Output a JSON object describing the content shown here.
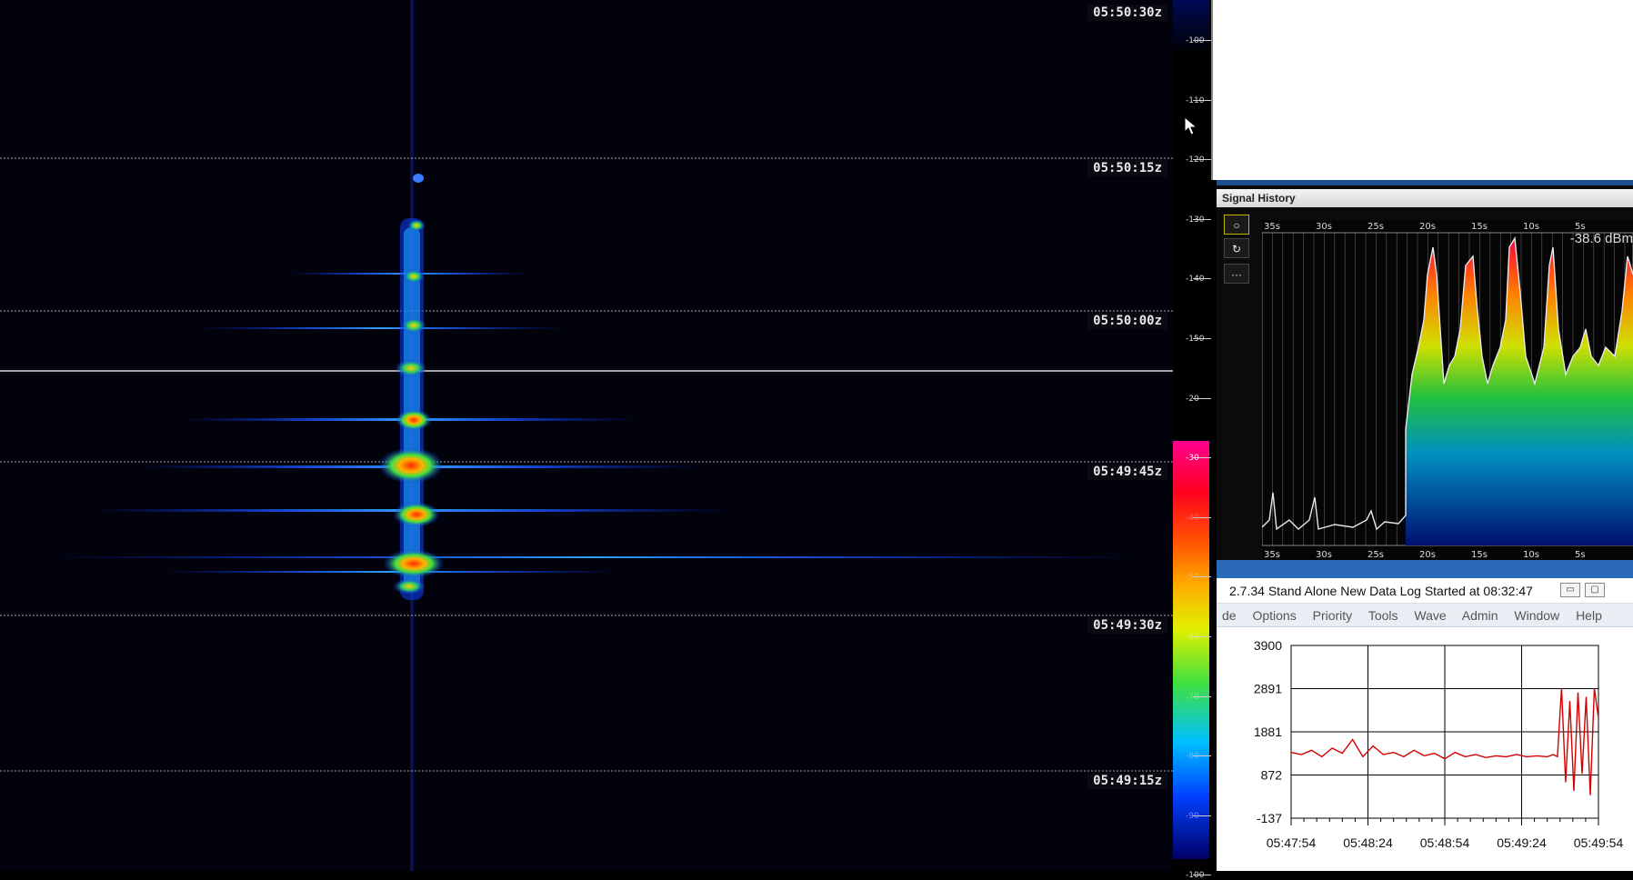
{
  "waterfall": {
    "timestamps": [
      "05:50:30z",
      "05:50:15z",
      "05:50:00z",
      "05:49:45z",
      "05:49:30z",
      "05:49:15z"
    ]
  },
  "color_scale": {
    "labels": [
      "-100",
      "-110",
      "-120",
      "-130",
      "-140",
      "-150",
      "-20",
      "-30",
      "-40",
      "-50",
      "-60",
      "-70",
      "-80",
      "-90",
      "-100"
    ],
    "label_colors": [
      "#d8d8d8",
      "#d8d8d8",
      "#d8d8d8",
      "#d8d8d8",
      "#d8d8d8",
      "#d8d8d8",
      "#d8d8d8",
      "#ffffff",
      "#ff6a6a",
      "#ffb060",
      "#e6f060",
      "#70f070",
      "#60c0ff",
      "#8080ff",
      "#d8d8d8"
    ]
  },
  "signal_history": {
    "title": "Signal History",
    "readout": "-38.6 dBm",
    "buttons": [
      "○",
      "↻",
      "···"
    ],
    "time_labels": [
      "35s",
      "30s",
      "25s",
      "20s",
      "15s",
      "10s",
      "5s"
    ]
  },
  "data_log": {
    "title": "2.7.34   Stand Alone   New Data Log Started at 08:32:47",
    "menu": [
      "de",
      "Options",
      "Priority",
      "Tools",
      "Wave",
      "Admin",
      "Window",
      "Help"
    ],
    "minimize_icon": "minimize-icon",
    "maximize_icon": "maximize-icon"
  },
  "chart_data": {
    "type": "line",
    "categories": [
      "05:47:54",
      "05:48:24",
      "05:48:54",
      "05:49:24",
      "05:49:54"
    ],
    "y_tick_labels": [
      "3900",
      "2891",
      "1881",
      "872",
      "-137"
    ],
    "ylim": [
      -137,
      3900
    ],
    "series": [
      {
        "color": "#d40000",
        "x_seconds": [
          0,
          5,
          10,
          15,
          20,
          25,
          30,
          35,
          40,
          45,
          50,
          55,
          60,
          65,
          70,
          75,
          80,
          85,
          90,
          95,
          100,
          105,
          110,
          115,
          120,
          125,
          128,
          130,
          132,
          134,
          136,
          138,
          140,
          142,
          144,
          146,
          148,
          150
        ],
        "values": [
          1400,
          1350,
          1450,
          1300,
          1500,
          1380,
          1700,
          1300,
          1550,
          1350,
          1400,
          1300,
          1450,
          1320,
          1380,
          1250,
          1400,
          1300,
          1350,
          1280,
          1320,
          1300,
          1350,
          1300,
          1320,
          1300,
          1350,
          1300,
          2900,
          700,
          2600,
          500,
          2800,
          900,
          2700,
          400,
          2900,
          2200
        ]
      }
    ],
    "grid": true
  }
}
